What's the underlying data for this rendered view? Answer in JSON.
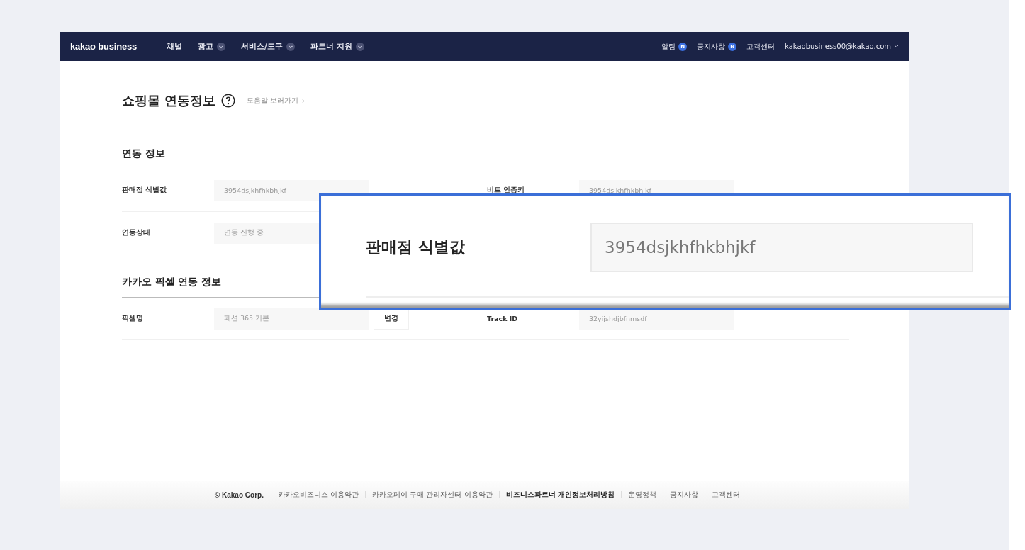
{
  "nav": {
    "logo": "kakao business",
    "menu": [
      {
        "label": "채널",
        "dropdown": false
      },
      {
        "label": "광고",
        "dropdown": true
      },
      {
        "label": "서비스/도구",
        "dropdown": true
      },
      {
        "label": "파트너 지원",
        "dropdown": true
      }
    ],
    "right": [
      {
        "kind": "badge",
        "label": "알림",
        "badge": "N"
      },
      {
        "kind": "badge",
        "label": "공지사항",
        "badge": "N"
      },
      {
        "kind": "link",
        "label": "고객센터"
      },
      {
        "kind": "account",
        "label": "kakaobusiness00@kakao.com"
      }
    ]
  },
  "page": {
    "title": "쇼핑몰 연동정보",
    "help_link": "도움말 보러가기"
  },
  "sections": [
    {
      "title": "연동 정보",
      "rows": [
        {
          "label": "판매점 식별값",
          "value": "3954dsjkhfhkbhjkf",
          "right_label": "비트 인증키",
          "right_value": "3954dsjkhfhkbhjkf"
        },
        {
          "label": "연동상태",
          "value": "연동 진행 중"
        }
      ]
    },
    {
      "title": "카카오 픽셀 연동 정보",
      "rows": [
        {
          "label": "픽셀명",
          "value": "패션 365 기본",
          "button": "변경",
          "right_label": "Track ID",
          "right_value": "32yijshdjbfnmsdf"
        }
      ]
    }
  ],
  "callout": {
    "label": "판매점 식별값",
    "value": "3954dsjkhfhkbhjkf"
  },
  "footer": {
    "copyright": "© Kakao Corp.",
    "links": [
      {
        "label": "카카오비즈니스 이용약관",
        "bold": false
      },
      {
        "label": "카카오페이 구매 관리자센터 이용약관",
        "bold": false
      },
      {
        "label": "비즈니스파트너 개인정보처리방침",
        "bold": true
      },
      {
        "label": "운영정책",
        "bold": false
      },
      {
        "label": "공지사항",
        "bold": false
      },
      {
        "label": "고객센터",
        "bold": false
      }
    ]
  }
}
